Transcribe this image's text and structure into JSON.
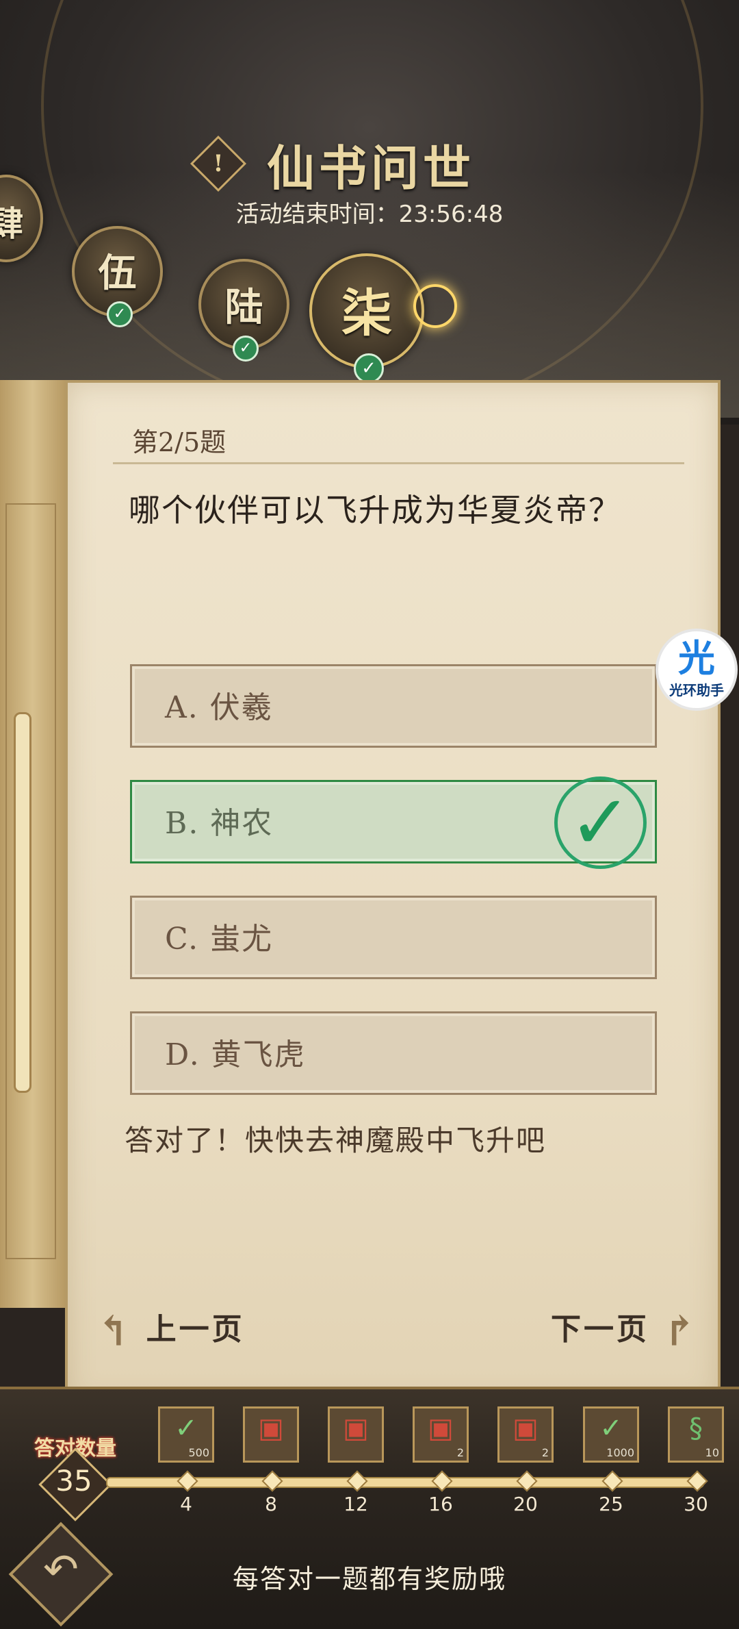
{
  "header": {
    "title": "仙书问世",
    "info_icon": "!",
    "timer_label": "活动结束时间：",
    "timer_value": "23:56:48"
  },
  "chapters": [
    {
      "label": "肆",
      "completed": true
    },
    {
      "label": "伍",
      "completed": true
    },
    {
      "label": "陆",
      "completed": true
    },
    {
      "label": "柒",
      "completed": true,
      "current": true
    }
  ],
  "question": {
    "number_label": "第2/5题",
    "text": "哪个伙伴可以飞升成为华夏炎帝？",
    "options": [
      {
        "label": "A. 伏羲",
        "correct": false
      },
      {
        "label": "B. 神农",
        "correct": true
      },
      {
        "label": "C. 蚩尤",
        "correct": false
      },
      {
        "label": "D. 黄飞虎",
        "correct": false
      }
    ],
    "feedback": "答对了！快快去神魔殿中飞升吧"
  },
  "navigation": {
    "prev_label": "上一页",
    "next_label": "下一页"
  },
  "floating_button": {
    "glyph": "光",
    "label": "光环助手"
  },
  "progress": {
    "label": "答对数量",
    "count": "35",
    "milestones": [
      "4",
      "8",
      "12",
      "16",
      "20",
      "25",
      "30"
    ],
    "rewards": [
      {
        "icon": "jade-icon",
        "qty": "500"
      },
      {
        "icon": "chest-icon",
        "qty": ""
      },
      {
        "icon": "chest-icon",
        "qty": ""
      },
      {
        "icon": "chest-icon",
        "qty": "2"
      },
      {
        "icon": "chest-icon",
        "qty": "2"
      },
      {
        "icon": "jade-icon",
        "qty": "1000"
      },
      {
        "icon": "dragon-icon",
        "qty": "10"
      }
    ],
    "tip": "每答对一题都有奖励哦"
  }
}
